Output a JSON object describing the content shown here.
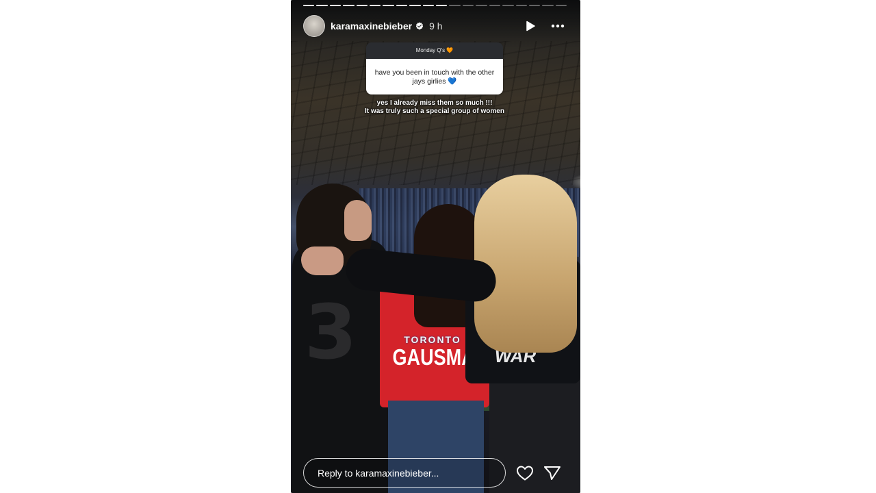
{
  "story": {
    "username": "karamaxinebieber",
    "timestamp": "9 h",
    "progress": {
      "segments_total": 20,
      "segments_done": 11
    }
  },
  "question_sticker": {
    "header": "Monday Q's 🧡",
    "question": "have you been in touch with the other jays girlies 💙"
  },
  "answer": {
    "line1": "yes I already miss them so much !!!",
    "line2": "It was truly such a special group of women"
  },
  "photo": {
    "jersey_number": "3",
    "jersey_team": "TORONTO",
    "jersey_name": "GAUSMAN",
    "jacket_text": "WAR"
  },
  "reply": {
    "placeholder": "Reply to karamaxinebieber..."
  },
  "icons": {
    "verified": "verified-badge-icon",
    "play": "play-icon",
    "more": "more-options-icon",
    "like": "heart-icon",
    "share": "send-icon"
  }
}
